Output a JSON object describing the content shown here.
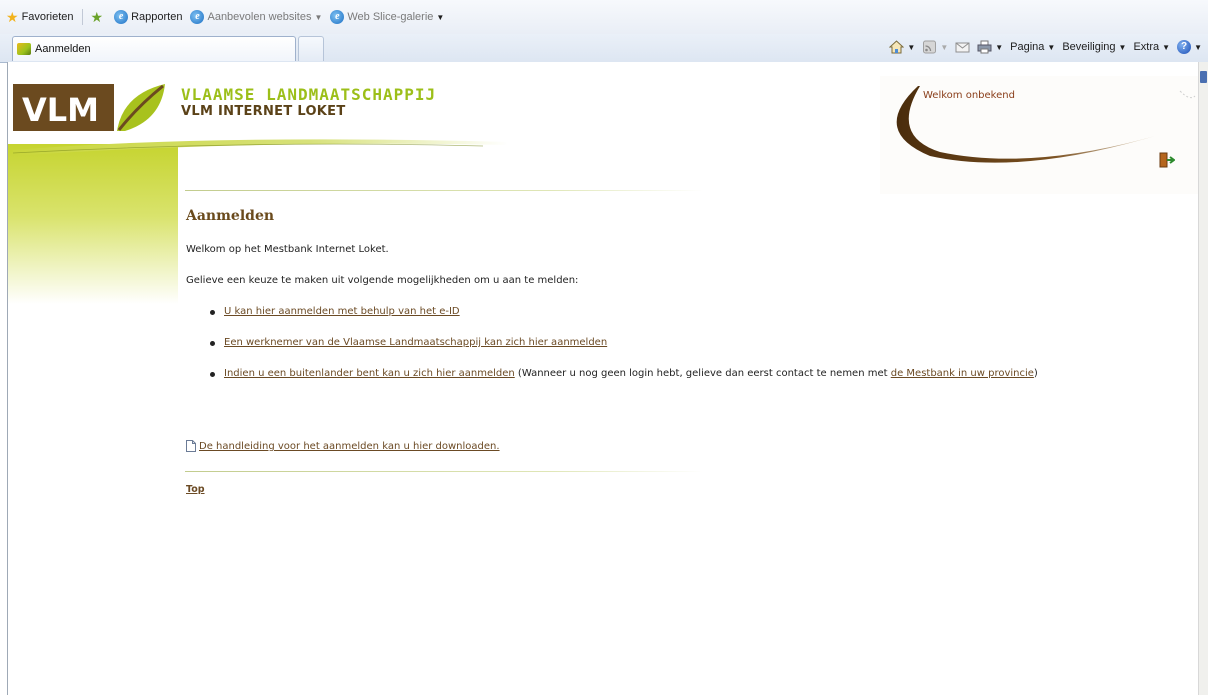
{
  "browser": {
    "favorites_bar": {
      "favorites_label": "Favorieten",
      "items": [
        {
          "label": "Rapporten"
        },
        {
          "label": "Aanbevolen websites"
        },
        {
          "label": "Web Slice-galerie"
        }
      ]
    },
    "tab": {
      "title": "Aanmelden"
    },
    "command_bar": {
      "page_label": "Pagina",
      "safety_label": "Beveiliging",
      "tools_label": "Extra"
    }
  },
  "header": {
    "logo_text": "VLM",
    "org_name": "VLAAMSE LANDMAATSCHAPPIJ",
    "site_name": "VLM INTERNET LOKET",
    "welcome": "Welkom onbekend"
  },
  "content": {
    "heading": "Aanmelden",
    "intro": "Welkom op het Mestbank Internet Loket.",
    "instruction": "Gelieve een keuze te maken uit volgende mogelijkheden om u aan te melden:",
    "options": [
      {
        "link": "U kan hier aanmelden met behulp van het e-ID"
      },
      {
        "link": "Een werknemer van de Vlaamse Landmaatschappij kan zich hier aanmelden"
      },
      {
        "link": "Indien u een buitenlander bent kan u zich hier aanmelden",
        "note_before": " (Wanneer u nog geen login hebt, gelieve dan eerst contact te nemen met ",
        "note_link": "de Mestbank in uw provincie",
        "note_after": ")"
      }
    ],
    "manual_link": "De handleiding voor het aanmelden kan u hier downloaden.",
    "top_link": "Top"
  },
  "colors": {
    "brand_brown": "#5b4218",
    "brand_green": "#9cbf19",
    "link": "#6b4a24",
    "heading": "#6a4a1c"
  }
}
